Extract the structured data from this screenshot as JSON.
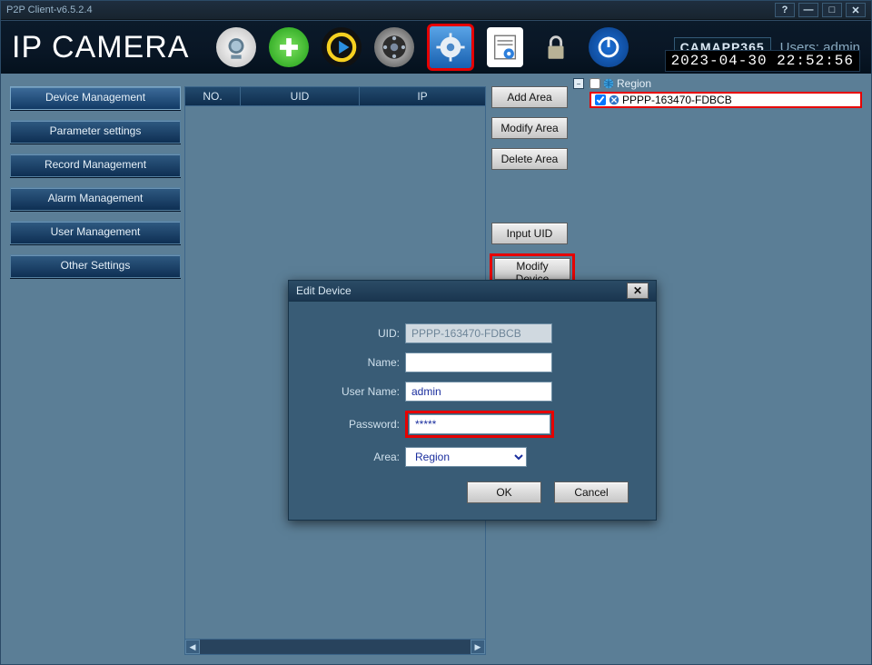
{
  "window": {
    "title": "P2P Client-v6.5.2.4"
  },
  "toolbar": {
    "brand": "IP CAMERA",
    "logo": "CAMAPP365",
    "users_label": "Users: admin",
    "datetime": "2023-04-30 22:52:56"
  },
  "sidebar": {
    "items": [
      {
        "label": "Device Management",
        "active": true
      },
      {
        "label": "Parameter settings"
      },
      {
        "label": "Record Management"
      },
      {
        "label": "Alarm Management"
      },
      {
        "label": "User Management"
      },
      {
        "label": "Other Settings"
      }
    ]
  },
  "list": {
    "headers": {
      "no": "NO.",
      "uid": "UID",
      "ip": "IP"
    }
  },
  "actions": {
    "add_area": "Add Area",
    "modify_area": "Modify Area",
    "delete_area": "Delete Area",
    "input_uid": "Input UID",
    "modify_device": "Modify Device"
  },
  "tree": {
    "root_label": "Region",
    "device_label": "PPPP-163470-FDBCB"
  },
  "dialog": {
    "title": "Edit Device",
    "labels": {
      "uid": "UID:",
      "name": "Name:",
      "user": "User Name:",
      "pw": "Password:",
      "area": "Area:"
    },
    "values": {
      "uid": "PPPP-163470-FDBCB",
      "name": "",
      "user": "admin",
      "pw": "*****",
      "area": "Region"
    },
    "ok": "OK",
    "cancel": "Cancel"
  }
}
